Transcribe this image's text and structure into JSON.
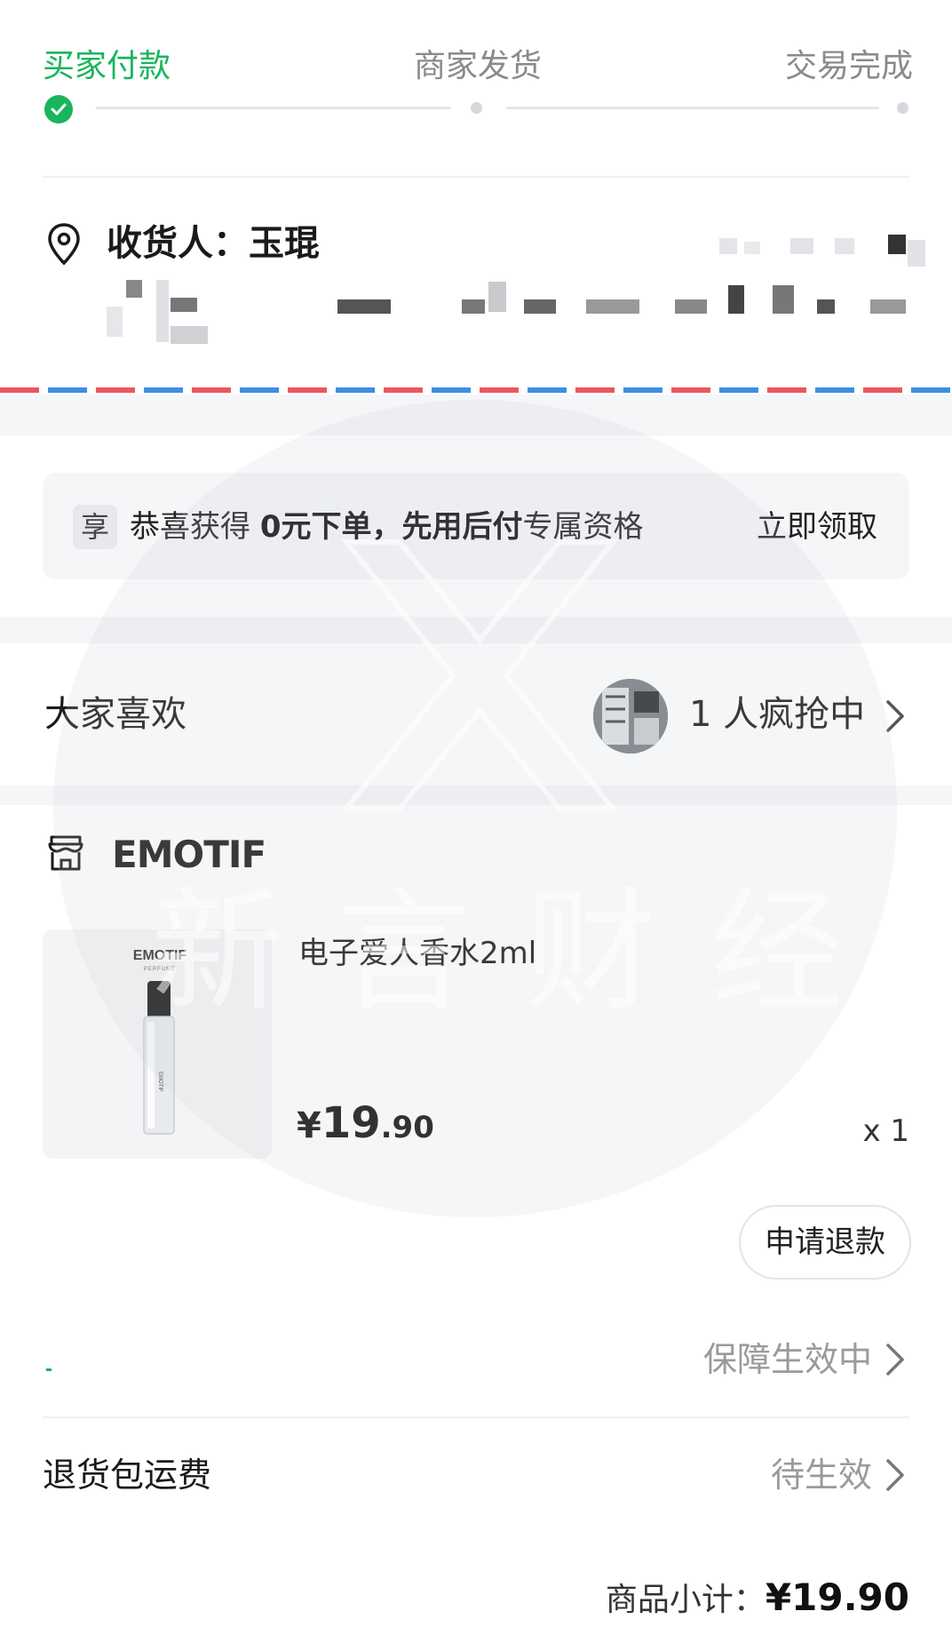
{
  "progress": {
    "steps": [
      {
        "label": "买家付款",
        "state": "done"
      },
      {
        "label": "商家发货",
        "state": "pending"
      },
      {
        "label": "交易完成",
        "state": "pending"
      }
    ],
    "accent": "#19b55c"
  },
  "address": {
    "recipient": "收货人：玉琨",
    "phone": "",
    "detail": ""
  },
  "promo": {
    "tag": "享",
    "text_prefix": "恭喜获得 ",
    "text_bold": "0元下单，先用后付",
    "text_suffix": "专属资格",
    "action": "立即领取"
  },
  "likes": {
    "title": "大家喜欢",
    "count_text": "1 人疯抢中"
  },
  "shop": {
    "name": "EMOTIF"
  },
  "product": {
    "brand_on_image": "EMOTIF",
    "brand_sub_on_image": "PERFUME",
    "name": "电子爱人香水2ml",
    "price_currency": "¥",
    "price_int": "19",
    "price_dec": ".90",
    "quantity": "x 1"
  },
  "actions": {
    "refund": "申请退款"
  },
  "guarantee": {
    "status": "保障生效中"
  },
  "return_shipping": {
    "label": "退货包运费",
    "status": "待生效"
  },
  "subtotal": {
    "label": "商品小计：",
    "amount": "¥19.90"
  },
  "watermark": {
    "text": "新言财经"
  },
  "icons": {
    "done": "check-circle-icon",
    "location": "location-pin-icon",
    "shop": "shop-icon",
    "chevron": "chevron-right-icon"
  }
}
